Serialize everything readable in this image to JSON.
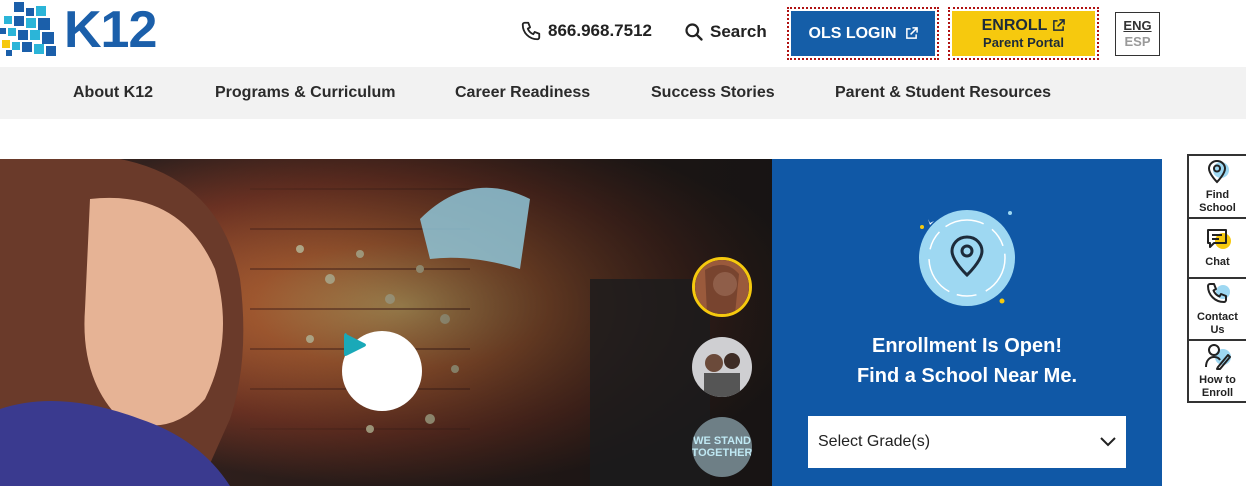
{
  "header": {
    "logo_text": "K12",
    "phone_number": "866.968.7512",
    "phone_icon": "phone-icon",
    "search_label": "Search",
    "search_icon": "search-icon",
    "ols_login_label": "OLS LOGIN",
    "enroll_label": "ENROLL",
    "enroll_sub_label": "Parent Portal",
    "external_icon": "external-link-icon",
    "lang_eng": "ENG",
    "lang_esp": "ESP"
  },
  "nav": {
    "items": [
      {
        "label": "About K12"
      },
      {
        "label": "Programs & Curriculum"
      },
      {
        "label": "Career Readiness"
      },
      {
        "label": "Success Stories"
      },
      {
        "label": "Parent & Student Resources"
      }
    ]
  },
  "hero": {
    "play_icon": "play-icon",
    "thumbnails": [
      {
        "icon": "student-portrait-thumbnail",
        "active": true
      },
      {
        "icon": "family-photo-thumbnail",
        "active": false
      },
      {
        "text_line1": "WE STAND",
        "text_line2": "TOGETHER",
        "active": false
      }
    ]
  },
  "enroll_panel": {
    "icon": "location-pin-icon",
    "title_line1": "Enrollment Is Open!",
    "title_line2": "Find a School Near Me.",
    "select_value": "Select Grade(s)"
  },
  "side_toolbar": {
    "items": [
      {
        "label_line1": "Find",
        "label_line2": "School",
        "icon": "location-pin-icon"
      },
      {
        "label_line1": "Chat",
        "label_line2": "",
        "icon": "chat-icon"
      },
      {
        "label_line1": "Contact",
        "label_line2": "Us",
        "icon": "phone-icon"
      },
      {
        "label_line1": "How to",
        "label_line2": "Enroll",
        "icon": "enroll-person-icon"
      }
    ]
  },
  "colors": {
    "brand_blue": "#155ea8",
    "brand_cyan": "#2bb5d8",
    "enroll_yellow": "#f6c90e",
    "panel_blue": "#1058a6",
    "nav_bg": "#f2f2f2"
  }
}
